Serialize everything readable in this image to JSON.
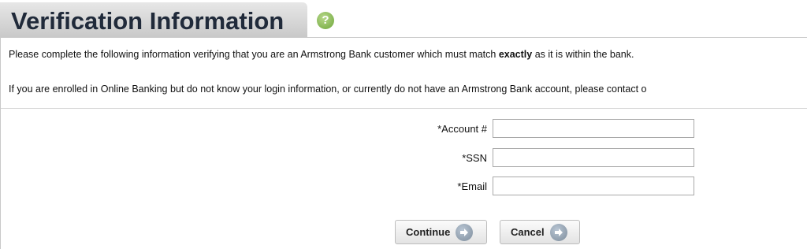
{
  "header": {
    "title": "Verification Information",
    "help_icon": "question-mark-icon",
    "help_glyph": "?"
  },
  "intro": {
    "line1_before": "Please complete the following information verifying that you are an Armstrong Bank customer which must match ",
    "line1_bold": "exactly",
    "line1_after": " as it is within the bank.",
    "line2": "If you are enrolled in Online Banking but do not know your login information, or currently do not have an Armstrong Bank account, please contact o"
  },
  "form": {
    "fields": [
      {
        "label": "*Account #",
        "value": ""
      },
      {
        "label": "*SSN",
        "value": ""
      },
      {
        "label": "*Email",
        "value": ""
      }
    ]
  },
  "buttons": {
    "continue_label": "Continue",
    "cancel_label": "Cancel",
    "icon": "arrow-right-circle-icon"
  },
  "colors": {
    "title_text": "#202a3a",
    "help_icon": "#6ea63a",
    "button_icon": "#7d8c9b"
  }
}
